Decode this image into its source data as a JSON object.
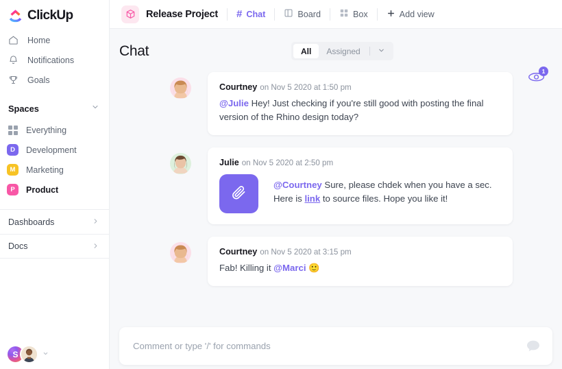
{
  "brand": {
    "name": "ClickUp",
    "accent": "#7b68ee",
    "logo_icon": "clickup-logo-icon"
  },
  "sidebar": {
    "nav": [
      {
        "label": "Home",
        "icon": "home-icon"
      },
      {
        "label": "Notifications",
        "icon": "bell-icon"
      },
      {
        "label": "Goals",
        "icon": "trophy-icon"
      }
    ],
    "spaces": {
      "title": "Spaces",
      "collapse_icon": "chevron-down-icon",
      "items": [
        {
          "label": "Everything",
          "icon": "grid-icon",
          "badge": "",
          "color": "",
          "active": false
        },
        {
          "label": "Development",
          "icon": "space-badge",
          "badge": "D",
          "color": "#7b68ee",
          "active": false
        },
        {
          "label": "Marketing",
          "icon": "space-badge",
          "badge": "M",
          "color": "#f7c325",
          "active": false
        },
        {
          "label": "Product",
          "icon": "space-badge",
          "badge": "P",
          "color": "#f857a6",
          "active": true
        }
      ]
    },
    "lower": [
      {
        "label": "Dashboards",
        "icon": "chevron-right-icon"
      },
      {
        "label": "Docs",
        "icon": "chevron-right-icon"
      }
    ],
    "footer": {
      "workspace_initial": "S",
      "workspace_avatar": "workspace-avatar",
      "user_avatar": "user-avatar",
      "chevron": "chevron-down-icon"
    }
  },
  "topbar": {
    "project_icon": "box-cube-icon",
    "project_title": "Release Project",
    "views": [
      {
        "label": "Chat",
        "icon": "hash-icon",
        "active": true
      },
      {
        "label": "Board",
        "icon": "board-icon",
        "active": false
      },
      {
        "label": "Box",
        "icon": "box-grid-icon",
        "active": false
      }
    ],
    "add_view": {
      "label": "Add view",
      "icon": "plus-icon"
    }
  },
  "chat": {
    "title": "Chat",
    "filters": {
      "all": "All",
      "assigned": "Assigned",
      "chevron": "chevron-down-icon"
    },
    "watchers": {
      "icon": "eye-icon",
      "count": "1"
    },
    "messages": [
      {
        "author": "Courtney",
        "time": "on Nov 5 2020 at 1:50 pm",
        "avatar": "avatar-courtney",
        "mention": "@Julie",
        "text": " Hey! Just checking if you're still good with posting the final version of the Rhino design today?",
        "has_attachment": false
      },
      {
        "author": "Julie",
        "time": "on Nov 5 2020 at 2:50 pm",
        "avatar": "avatar-julie",
        "mention": "@Courtney",
        "text_before_link": " Sure, please chdek when you have a sec. Here is ",
        "link_label": "link",
        "text_after_link": " to source files. Hope you like it!",
        "has_attachment": true,
        "attachment_icon": "paperclip-icon"
      },
      {
        "author": "Courtney",
        "time": "on Nov 5 2020 at 3:15 pm",
        "avatar": "avatar-courtney",
        "text_before_mention": "Fab! Killing it ",
        "mention": "@Marci",
        "emoji": "🙂",
        "has_attachment": false
      }
    ],
    "composer": {
      "placeholder": "Comment or type '/' for commands",
      "icon": "chat-bubble-icon"
    }
  }
}
